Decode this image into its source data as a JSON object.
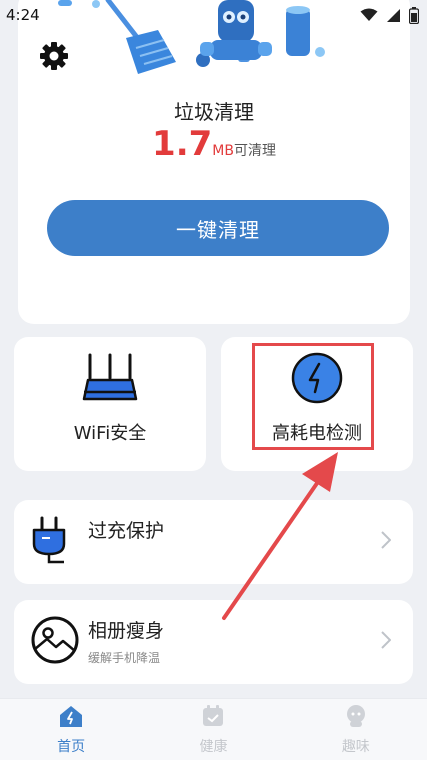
{
  "status_bar": {
    "time": "4:24"
  },
  "cleaner": {
    "title": "垃圾清理",
    "size_value": "1.7",
    "size_unit": "MB",
    "size_suffix": "可清理",
    "button_label": "一键清理"
  },
  "tiles": [
    {
      "label": "WiFi安全",
      "icon": "router-icon"
    },
    {
      "label": "高耗电检测",
      "icon": "lightning-icon"
    }
  ],
  "rows": [
    {
      "title": "过充保护",
      "subtitle": "",
      "icon": "plug-icon"
    },
    {
      "title": "相册瘦身",
      "subtitle": "缓解手机降温",
      "icon": "photo-icon"
    }
  ],
  "tabbar": [
    {
      "label": "首页",
      "active": true,
      "icon": "home-icon"
    },
    {
      "label": "健康",
      "active": false,
      "icon": "calendar-icon"
    },
    {
      "label": "趣味",
      "active": false,
      "icon": "face-icon"
    }
  ],
  "colors": {
    "accent": "#3d7fc9",
    "size_red": "#e23b3b",
    "annotation_red": "#e4494b",
    "background": "#eef0f4"
  }
}
